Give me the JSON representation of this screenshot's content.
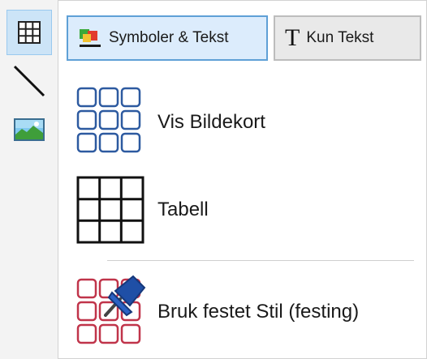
{
  "sidebar": {
    "items": [
      {
        "icon": "table-grid-icon",
        "active": true
      },
      {
        "icon": "line-icon",
        "active": false
      },
      {
        "icon": "image-icon",
        "active": false
      }
    ]
  },
  "mode_buttons": {
    "symbols_text": "Symboler & Tekst",
    "text_only": "Kun Tekst",
    "text_only_glyph": "T"
  },
  "options": {
    "cards": "Vis Bildekort",
    "table": "Tabell",
    "pinned": "Bruk festet Stil (festing)"
  },
  "colors": {
    "active_bg": "#cce4f7",
    "active_border": "#99c9ef",
    "card_blue": "#2d5aa0",
    "card_red": "#c0344a",
    "pin_blue": "#1f4fa6"
  }
}
